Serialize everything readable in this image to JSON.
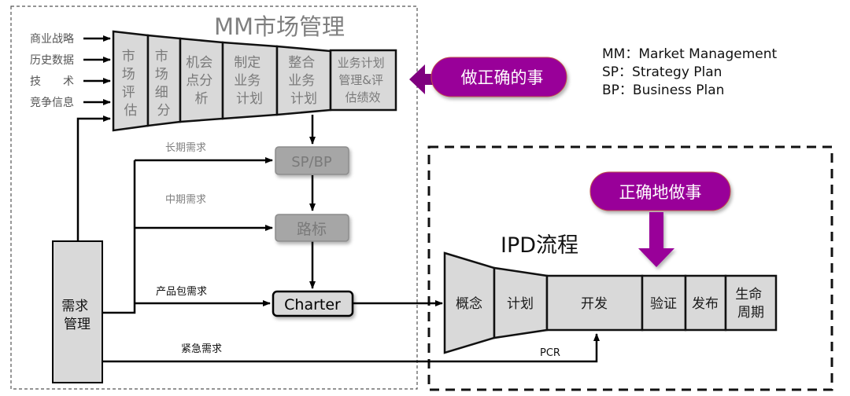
{
  "mm": {
    "title": "MM市场管理",
    "inputs": [
      "商业战略",
      "历史数据",
      "技　　术",
      "竞争信息"
    ],
    "stages": [
      {
        "lines": [
          "市",
          "场",
          "评",
          "估"
        ]
      },
      {
        "lines": [
          "市",
          "场",
          "细",
          "分"
        ]
      },
      {
        "lines": [
          "机会",
          "点分",
          "析"
        ]
      },
      {
        "lines": [
          "制定",
          "业务",
          "计划"
        ]
      },
      {
        "lines": [
          "整合",
          "业务",
          "计划"
        ]
      },
      {
        "lines": [
          "业务计划",
          "管理&评",
          "估绩效"
        ]
      }
    ]
  },
  "callouts": {
    "do_right_things": "做正确的事",
    "do_things_right": "正确地做事"
  },
  "legend": [
    "MM：Market Management",
    "SP：Strategy Plan",
    "BP：Business Plan"
  ],
  "flow": {
    "long_term": "长期需求",
    "mid_term": "中期需求",
    "product_package": "产品包需求",
    "urgent": "紧急需求",
    "pcr": "PCR",
    "sp_bp": "SP/BP",
    "roadmap": "路标",
    "charter": "Charter",
    "demand_mgmt": [
      "需求",
      "管理"
    ]
  },
  "ipd": {
    "title": "IPD流程",
    "stages": [
      {
        "lines": [
          "概念"
        ]
      },
      {
        "lines": [
          "计划"
        ]
      },
      {
        "lines": [
          "开发"
        ]
      },
      {
        "lines": [
          "验证"
        ]
      },
      {
        "lines": [
          "发布"
        ]
      },
      {
        "lines": [
          "生命",
          "周期"
        ]
      }
    ]
  },
  "colors": {
    "purple": "#990099",
    "stage_fill": "#d9d9d9",
    "muted_box": "#a6a6a6",
    "muted_text": "#808080"
  }
}
